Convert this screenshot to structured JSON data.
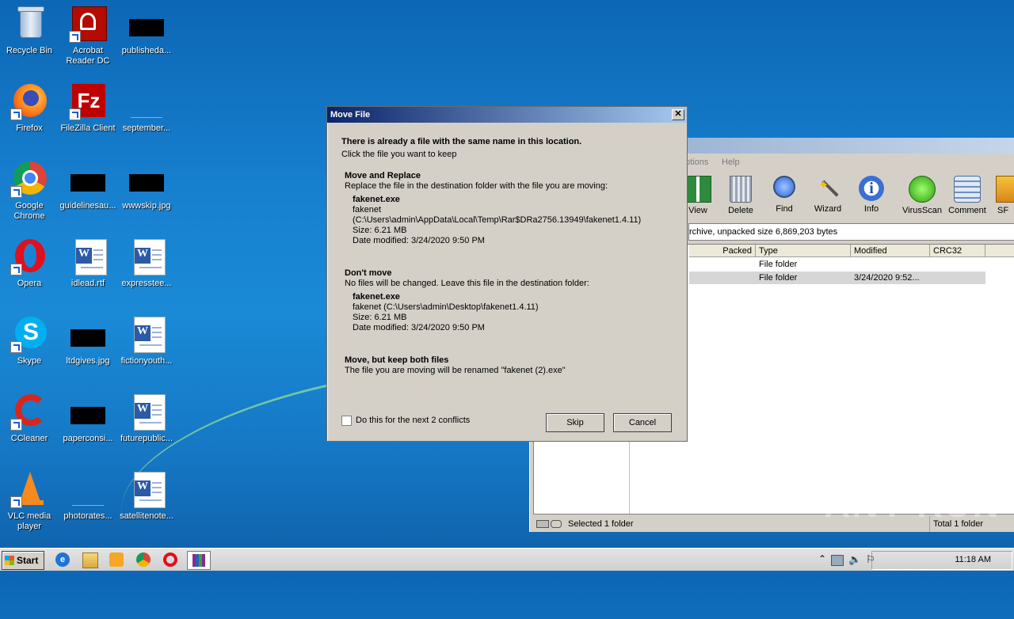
{
  "desktop": {
    "icons": [
      {
        "label": "Recycle Bin"
      },
      {
        "label": "Acrobat Reader DC"
      },
      {
        "label": "publisheda..."
      },
      {
        "label": "Firefox"
      },
      {
        "label": "FileZilla Client"
      },
      {
        "label": "september..."
      },
      {
        "label": "Google Chrome"
      },
      {
        "label": "guidelinesau..."
      },
      {
        "label": "wwwskip.jpg"
      },
      {
        "label": "Opera"
      },
      {
        "label": "idlead.rtf"
      },
      {
        "label": "expresstee..."
      },
      {
        "label": "Skype"
      },
      {
        "label": "ltdgives.jpg"
      },
      {
        "label": "fictionyouth..."
      },
      {
        "label": "CCleaner"
      },
      {
        "label": "paperconsi..."
      },
      {
        "label": "futurepublic..."
      },
      {
        "label": "VLC media player"
      },
      {
        "label": "photorates..."
      },
      {
        "label": "satellitenote..."
      }
    ]
  },
  "dialog": {
    "title": "Move File",
    "close": "✕",
    "heading": "There is already a file with the same name in this location.",
    "subheading": "Click the file you want to keep",
    "option1": {
      "title": "Move and Replace",
      "desc": "Replace the file in the destination folder with the file you are moving:",
      "filename": "fakenet.exe",
      "line1": "fakenet",
      "line2": "(C:\\Users\\admin\\AppData\\Local\\Temp\\Rar$DRa2756.13949\\fakenet1.4.11)",
      "size": "Size: 6.21 MB",
      "date": "Date modified: 3/24/2020 9:50 PM"
    },
    "option2": {
      "title": "Don't move",
      "desc": "No files will be changed. Leave this file in the destination folder:",
      "filename": "fakenet.exe",
      "line1": "fakenet (C:\\Users\\admin\\Desktop\\fakenet1.4.11)",
      "size": "Size: 6.21 MB",
      "date": "Date modified: 3/24/2020 9:50 PM"
    },
    "option3": {
      "title": "Move, but keep both files",
      "desc": "The file you are moving will be renamed \"fakenet (2).exe\""
    },
    "checkbox_label": "Do this for the next 2 conflicts",
    "skip": "Skip",
    "cancel": "Cancel"
  },
  "winrar": {
    "menu": [
      "ptions",
      "Help"
    ],
    "toolbar": [
      {
        "label": "View",
        "icon": "book-icon"
      },
      {
        "label": "Delete",
        "icon": "trash-icon"
      },
      {
        "label": "Find",
        "icon": "magnifier-icon"
      },
      {
        "label": "Wizard",
        "icon": "wand-icon"
      },
      {
        "label": "Info",
        "icon": "info-icon"
      },
      {
        "label": "VirusScan",
        "icon": "virus-icon"
      },
      {
        "label": "Comment",
        "icon": "comment-icon"
      },
      {
        "label": "SF",
        "icon": "sfx-icon"
      }
    ],
    "path": "rchive, unpacked size 6,869,203 bytes",
    "columns": [
      "Packed",
      "Type",
      "Modified",
      "CRC32"
    ],
    "rows": [
      {
        "type": "File folder",
        "modified": ""
      },
      {
        "type": "File folder",
        "modified": "3/24/2020 9:52..."
      }
    ],
    "status_left": "Selected 1 folder",
    "status_right": "Total 1 folder"
  },
  "taskbar": {
    "start": "Start",
    "clock": "11:18 AM"
  },
  "watermark": "ANY RUN"
}
